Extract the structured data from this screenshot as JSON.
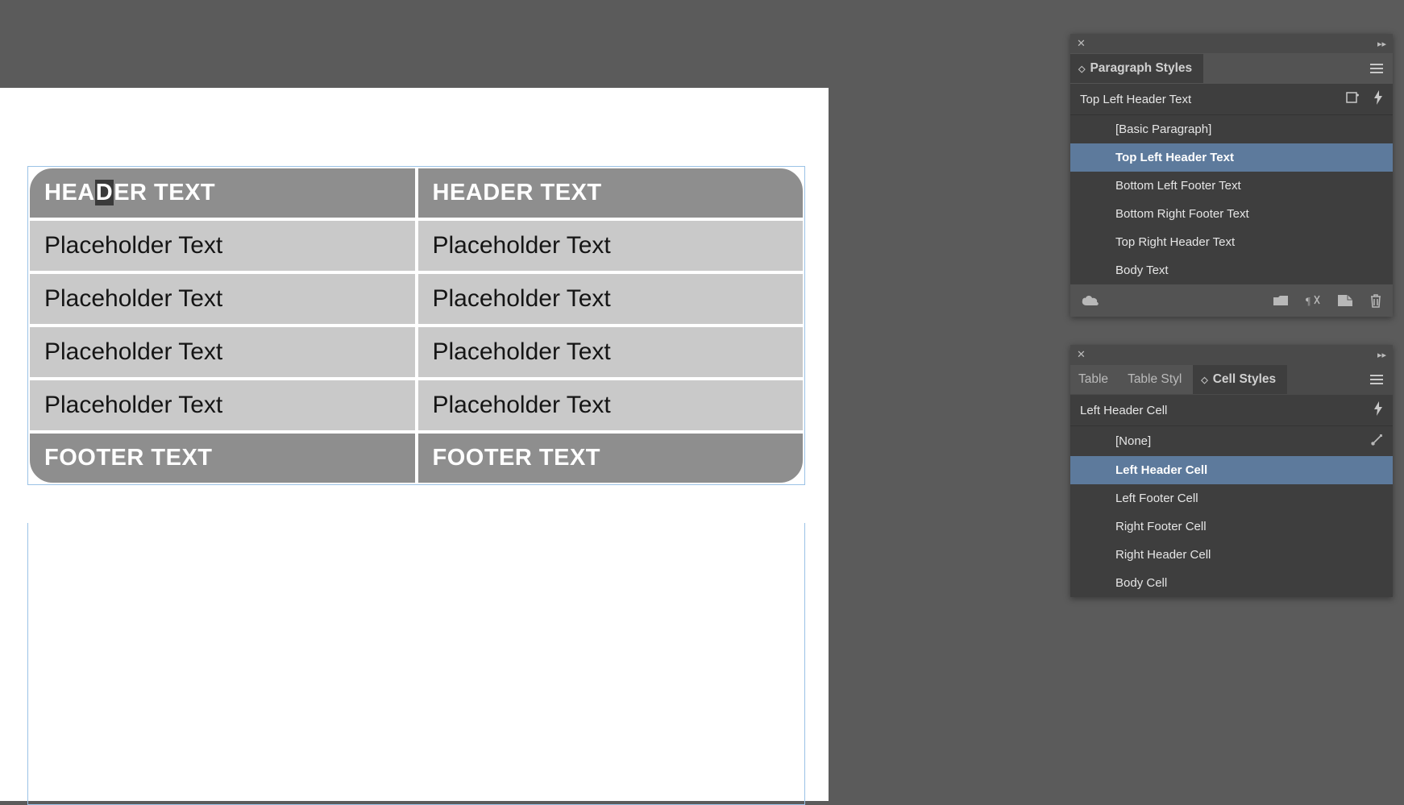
{
  "canvas": {
    "table": {
      "header": {
        "left_pre": "HEA",
        "left_hl": "D",
        "left_post": "ER TEXT",
        "right": "HEADER TEXT"
      },
      "body": [
        {
          "left": "Placeholder Text",
          "right": "Placeholder Text"
        },
        {
          "left": "Placeholder Text",
          "right": "Placeholder Text"
        },
        {
          "left": "Placeholder Text",
          "right": "Placeholder Text"
        },
        {
          "left": "Placeholder Text",
          "right": "Placeholder Text"
        }
      ],
      "footer": {
        "left": "FOOTER TEXT",
        "right": "FOOTER TEXT"
      }
    }
  },
  "paragraph_panel": {
    "title": "Paragraph Styles",
    "current": "Top Left Header Text",
    "items": [
      {
        "label": "[Basic Paragraph]"
      },
      {
        "label": "Top Left Header Text",
        "selected": true
      },
      {
        "label": "Bottom Left Footer Text"
      },
      {
        "label": "Bottom Right Footer Text"
      },
      {
        "label": "Top Right Header Text"
      },
      {
        "label": "Body Text"
      }
    ]
  },
  "cell_panel": {
    "tabs": {
      "table": "Table",
      "table_styles": "Table Styl",
      "cell_styles": "Cell Styles"
    },
    "current": "Left Header Cell",
    "items": [
      {
        "label": "[None]",
        "locked": true
      },
      {
        "label": "Left Header Cell",
        "selected": true
      },
      {
        "label": "Left Footer Cell"
      },
      {
        "label": "Right Footer Cell"
      },
      {
        "label": "Right Header Cell"
      },
      {
        "label": "Body Cell"
      }
    ]
  }
}
